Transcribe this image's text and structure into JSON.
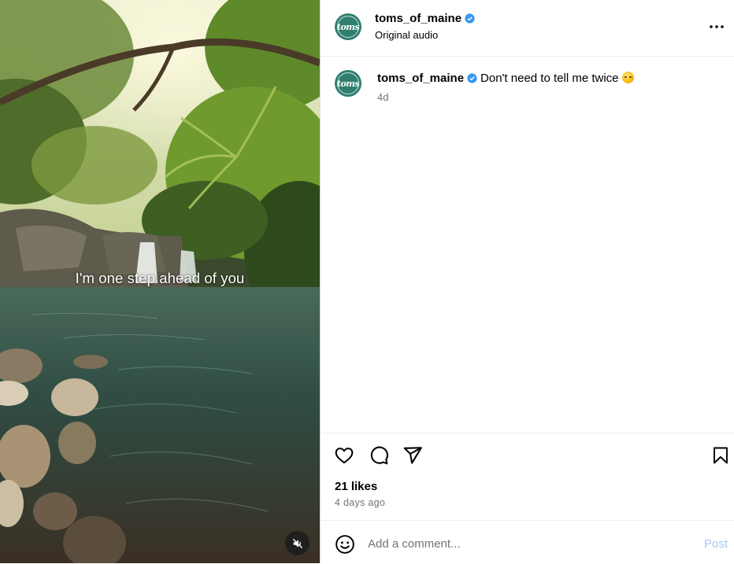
{
  "media": {
    "caption_overlay": "I'm one step ahead of you",
    "mute_icon": "speaker-muted-icon"
  },
  "post": {
    "author": "toms_of_maine",
    "avatar_text": "toms",
    "audio_label": "Original audio",
    "verified_color": "#3797f0",
    "more_icon": "more-horizontal-icon"
  },
  "comment": {
    "username": "toms_of_maine",
    "text": "Don't need to tell me twice",
    "emoji": "smirk-face-emoji",
    "time": "4d"
  },
  "actions": {
    "icons": [
      "heart-icon",
      "comment-icon",
      "share-icon",
      "bookmark-icon"
    ],
    "likes": "21 likes",
    "date": "4 days ago"
  },
  "composer": {
    "placeholder": "Add a comment...",
    "post_label": "Post",
    "post_color": "#a7c6f5"
  },
  "colors": {
    "brand_avatar": "#2f7f6e",
    "secondary_text": "#737373",
    "divider": "#efefef"
  }
}
